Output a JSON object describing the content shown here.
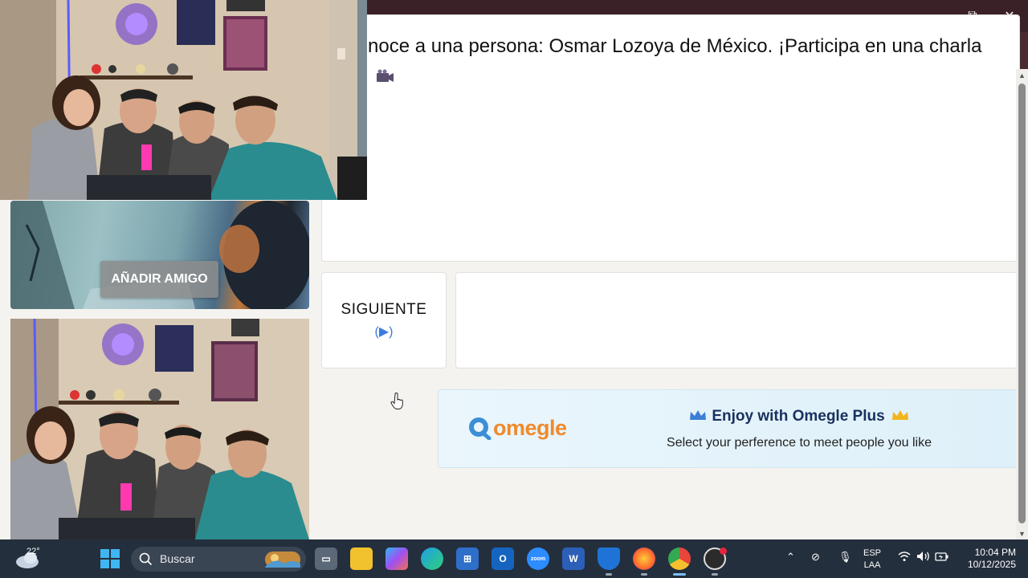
{
  "browser": {
    "window_controls": {
      "minimize": "─",
      "maximize": "⧉",
      "close": "✕"
    }
  },
  "chat": {
    "message": "noce a una persona: Osmar Lozoya de México. ¡Participa en una charla"
  },
  "video": {
    "add_friend_label": "AÑADIR AMIGO"
  },
  "controls": {
    "next_label": "SIGUIENTE",
    "next_sub": "(▶)"
  },
  "banner": {
    "logo_text": "omegle",
    "title": "Enjoy with Omegle Plus",
    "subtitle": "Select your perference to meet people you like",
    "accent_color": "#f08a2c",
    "title_color": "#19305e"
  },
  "taskbar": {
    "temperature": "22°",
    "search_label": "Buscar",
    "language": "ESP",
    "layout": "LAA",
    "time": "10:04 PM",
    "date": "10/12/2025"
  }
}
